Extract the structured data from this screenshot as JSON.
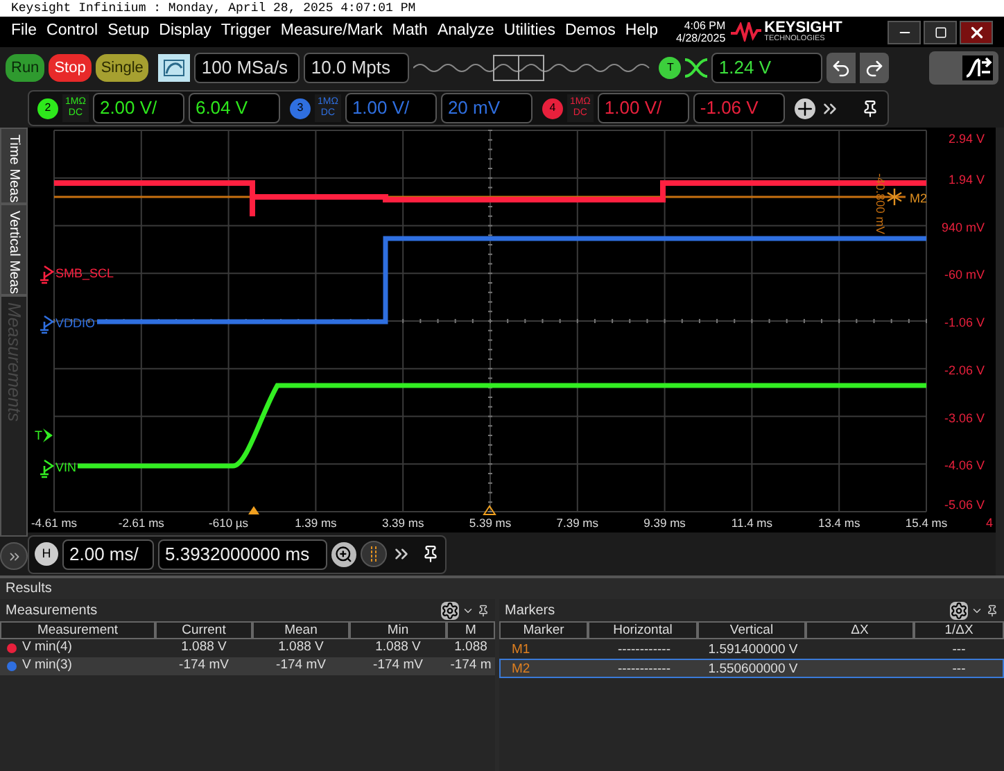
{
  "title_bar": {
    "text": "Keysight Infiniium : Monday, April 28, 2025 4:07:01 PM"
  },
  "menu": [
    "File",
    "Control",
    "Setup",
    "Display",
    "Trigger",
    "Measure/Mark",
    "Math",
    "Analyze",
    "Utilities",
    "Demos",
    "Help"
  ],
  "clock": {
    "time": "4:06 PM",
    "date": "4/28/2025"
  },
  "brand": {
    "name": "KEYSIGHT",
    "tagline": "TECHNOLOGIES"
  },
  "acquisition": {
    "buttons": [
      {
        "label": "Run",
        "kind": "run"
      },
      {
        "label": "Stop",
        "kind": "stop"
      },
      {
        "label": "Single",
        "kind": "single"
      }
    ],
    "sample_rate": "100 MSa/s",
    "memory_depth": "10.0 Mpts"
  },
  "trigger": {
    "label": "T",
    "value": "1.24 V"
  },
  "channels": [
    {
      "number": "2",
      "impedance": "1MΩ",
      "coupling": "DC",
      "scale": "2.00 V/",
      "offset": "6.04 V",
      "color": "#2ee81c"
    },
    {
      "number": "3",
      "impedance": "1MΩ",
      "coupling": "DC",
      "scale": "1.00 V/",
      "offset": "20 mV",
      "color": "#2f6fe0"
    },
    {
      "number": "4",
      "impedance": "1MΩ",
      "coupling": "DC",
      "scale": "1.00 V/",
      "offset": "-1.06 V",
      "color": "#e8203c"
    }
  ],
  "side_tabs": [
    {
      "label": "Time Meas",
      "disabled": false
    },
    {
      "label": "Vertical Meas",
      "disabled": false
    },
    {
      "label": "Measurements",
      "disabled": true
    }
  ],
  "display": {
    "y_labels": [
      "2.94 V",
      "1.94 V",
      "940 mV",
      "-60 mV",
      "-1.06 V",
      "-2.06 V",
      "-3.06 V",
      "-4.06 V",
      "-5.06 V"
    ],
    "x_labels": [
      "-4.61 ms",
      "-2.61 ms",
      "-610 µs",
      "1.39 ms",
      "3.39 ms",
      "5.39 ms",
      "7.39 ms",
      "9.39 ms",
      "11.4 ms",
      "13.4 ms",
      "15.4 ms"
    ],
    "axis_channel": "4",
    "traces": [
      {
        "name": "SMB_SCL",
        "color": "#ff2040"
      },
      {
        "name": "VDDIO",
        "color": "#2f6fe0"
      },
      {
        "name": "VIN",
        "color": "#33ee22"
      }
    ],
    "trigger_mark": "T",
    "marker": {
      "name": "M2",
      "reading": "-40.800 mV"
    }
  },
  "horizontal": {
    "label": "H",
    "scale": "2.00 ms/",
    "position": "5.3932000000 ms"
  },
  "results": {
    "title": "Results",
    "measurements": {
      "title": "Measurements",
      "columns": [
        "Measurement",
        "Current",
        "Mean",
        "Min",
        "M"
      ],
      "rows": [
        {
          "color": "#e8203c",
          "cells": [
            "V min(4)",
            "1.088 V",
            "1.088 V",
            "1.088 V",
            "1.088"
          ]
        },
        {
          "color": "#2f6fe0",
          "cells": [
            "V min(3)",
            "-174 mV",
            "-174 mV",
            "-174 mV",
            "-174 m"
          ]
        }
      ]
    },
    "markers": {
      "title": "Markers",
      "columns": [
        "Marker",
        "Horizontal",
        "Vertical",
        "ΔX",
        "1/ΔX"
      ],
      "rows": [
        {
          "marker": "M1",
          "horizontal": "------------",
          "vertical": "1.591400000 V",
          "inverse_dx": "---",
          "selected": false
        },
        {
          "marker": "M2",
          "horizontal": "------------",
          "vertical": "1.550600000 V",
          "inverse_dx": "---",
          "selected": true
        }
      ]
    }
  }
}
